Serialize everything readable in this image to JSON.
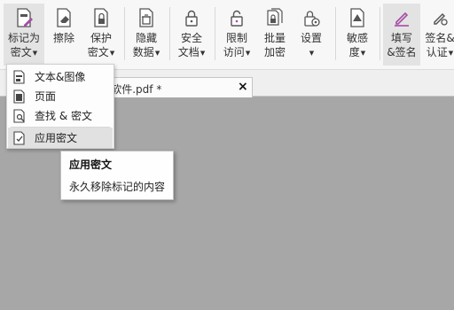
{
  "toolbar": {
    "items": [
      {
        "label1": "标记为",
        "label2": "密文",
        "has_dropdown": true,
        "icon": "mark-redaction-icon"
      },
      {
        "label1": "擦除",
        "label2": "",
        "has_dropdown": false,
        "icon": "eraser-icon"
      },
      {
        "label1": "保护",
        "label2": "密文",
        "has_dropdown": true,
        "icon": "protect-redaction-icon"
      },
      {
        "label1": "隐藏",
        "label2": "数据",
        "has_dropdown": true,
        "icon": "hide-data-icon"
      },
      {
        "label1": "安全",
        "label2": "文档",
        "has_dropdown": true,
        "icon": "secure-document-icon"
      },
      {
        "label1": "限制",
        "label2": "访问",
        "has_dropdown": true,
        "icon": "restrict-access-icon"
      },
      {
        "label1": "批量",
        "label2": "加密",
        "has_dropdown": false,
        "icon": "batch-encrypt-icon"
      },
      {
        "label1": "设置",
        "label2": "",
        "has_dropdown": true,
        "icon": "settings-icon"
      },
      {
        "label1": "敏感",
        "label2": "度",
        "has_dropdown": true,
        "icon": "sensitivity-icon"
      },
      {
        "label1": "填写",
        "label2": "&签名",
        "has_dropdown": false,
        "icon": "fill-sign-icon"
      },
      {
        "label1": "签名&",
        "label2": "认证",
        "has_dropdown": true,
        "icon": "sign-certify-icon"
      }
    ]
  },
  "document_tab": {
    "title": "f软件.pdf *",
    "close": "×"
  },
  "dropdown_menu": {
    "items": [
      {
        "label": "文本&图像",
        "icon": "text-image-icon"
      },
      {
        "label": "页面",
        "icon": "page-icon"
      },
      {
        "label": "查找 & 密文",
        "icon": "find-redact-icon"
      },
      {
        "label": "应用密文",
        "icon": "apply-redaction-icon"
      }
    ]
  },
  "tooltip": {
    "title": "应用密文",
    "description": "永久移除标记的内容"
  },
  "colors": {
    "accent": "#a64ca6",
    "workspace": "#a7a7a7"
  }
}
